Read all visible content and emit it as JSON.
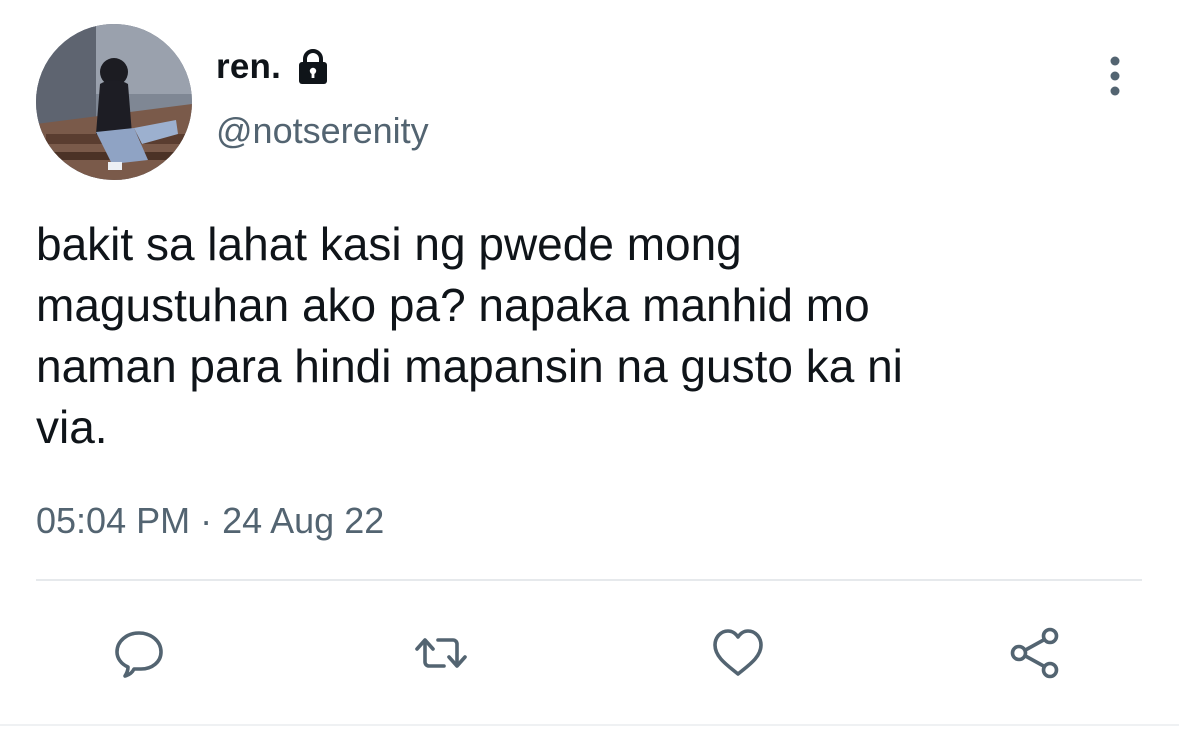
{
  "author": {
    "display_name": "ren.",
    "handle": "@notserenity",
    "protected_icon": "lock-icon"
  },
  "tweet": {
    "text": "bakit sa lahat kasi ng pwede mong\nmagustuhan ako pa? napaka manhid mo\nnaman para hindi mapansin na gusto ka ni\nvia.",
    "time": "05:04 PM",
    "separator": "·",
    "date": "24 Aug 22"
  },
  "actions": [
    {
      "name": "reply",
      "icon": "speech-bubble-icon"
    },
    {
      "name": "retweet",
      "icon": "retweet-arrows-icon"
    },
    {
      "name": "like",
      "icon": "heart-icon"
    },
    {
      "name": "share",
      "icon": "share-nodes-icon"
    }
  ],
  "menu_icon": "vertical-ellipsis-icon",
  "colors": {
    "text_primary": "#0f1419",
    "text_secondary": "#536471",
    "icon": "#536471",
    "divider": "#e6e9ec"
  }
}
